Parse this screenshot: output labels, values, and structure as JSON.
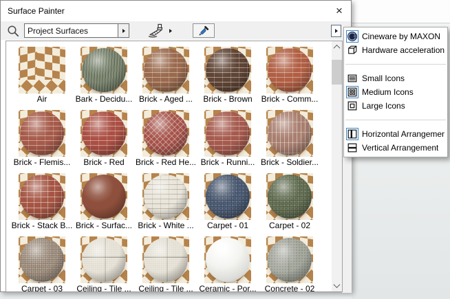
{
  "window": {
    "title": "Surface Painter",
    "close_glyph": "×"
  },
  "toolbar": {
    "search_icon": "search-icon",
    "filter_value": "Project Surfaces",
    "paint_tool_icon": "paint-brush-icon",
    "pick_tool_icon": "eyedropper-icon",
    "flyout_icon": "flyout-arrow-icon"
  },
  "colors": {
    "selection_blue": "#3a86c8",
    "toolbar_gray": "#f0f0f0",
    "checker_tan": "#b5834b",
    "checker_cream": "#f3ecdb",
    "scroll_thumb": "#cdcdcd"
  },
  "menu": {
    "items": [
      {
        "label": "Cineware by MAXON",
        "icon": "cineware-icon",
        "selected": true
      },
      {
        "label": "Hardware acceleration",
        "icon": "cube-icon",
        "selected": false
      },
      {
        "type": "separator"
      },
      {
        "label": "Small Icons",
        "icon": "small-icons-icon",
        "selected": false
      },
      {
        "label": "Medium Icons",
        "icon": "medium-icons-icon",
        "selected": true
      },
      {
        "label": "Large Icons",
        "icon": "large-icons-icon",
        "selected": false
      },
      {
        "type": "separator"
      },
      {
        "label": "Horizontal Arrangement",
        "icon": "horizontal-split-icon",
        "selected": true
      },
      {
        "label": "Vertical Arrangement",
        "icon": "vertical-split-icon",
        "selected": false
      }
    ]
  },
  "grid": {
    "tiles": [
      {
        "label": "Air",
        "material": "none",
        "color": ""
      },
      {
        "label": "Bark - Decidu...",
        "material": "bark",
        "color": "#7e8872"
      },
      {
        "label": "Brick - Aged ...",
        "material": "brick",
        "color": "#9a6a4e"
      },
      {
        "label": "Brick - Brown",
        "material": "brick",
        "color": "#5f4536"
      },
      {
        "label": "Brick - Comm...",
        "material": "brick",
        "color": "#b15f44"
      },
      {
        "label": "Brick - Flemis...",
        "material": "brick",
        "color": "#a65a4a"
      },
      {
        "label": "Brick - Red",
        "material": "brick",
        "color": "#ab4f44"
      },
      {
        "label": "Brick - Red He...",
        "material": "herringbone",
        "color": "#a5524a"
      },
      {
        "label": "Brick - Runni...",
        "material": "brick",
        "color": "#a65a4e"
      },
      {
        "label": "Brick - Soldier...",
        "material": "soldier",
        "color": "#a87f70"
      },
      {
        "label": "Brick - Stack B...",
        "material": "stack",
        "color": "#a55544"
      },
      {
        "label": "Brick - Surfac...",
        "material": "plain",
        "color": "#8e4f3c"
      },
      {
        "label": "Brick - White ...",
        "material": "brick-light",
        "color": "#e9e5da"
      },
      {
        "label": "Carpet - 01",
        "material": "carpet",
        "color": "#54657f"
      },
      {
        "label": "Carpet - 02",
        "material": "carpet",
        "color": "#6e7b5c"
      },
      {
        "label": "Carpet - 03",
        "material": "carpet",
        "color": "#b2a08f"
      },
      {
        "label": "Ceiling - Tile ...",
        "material": "tile",
        "color": "#ece8dd"
      },
      {
        "label": "Ceiling - Tile ...",
        "material": "tile",
        "color": "#ece8dd"
      },
      {
        "label": "Ceramic - Por...",
        "material": "gloss",
        "color": "#f4f4f1"
      },
      {
        "label": "Concrete - 02",
        "material": "concrete",
        "color": "#a7aa9f"
      }
    ]
  }
}
